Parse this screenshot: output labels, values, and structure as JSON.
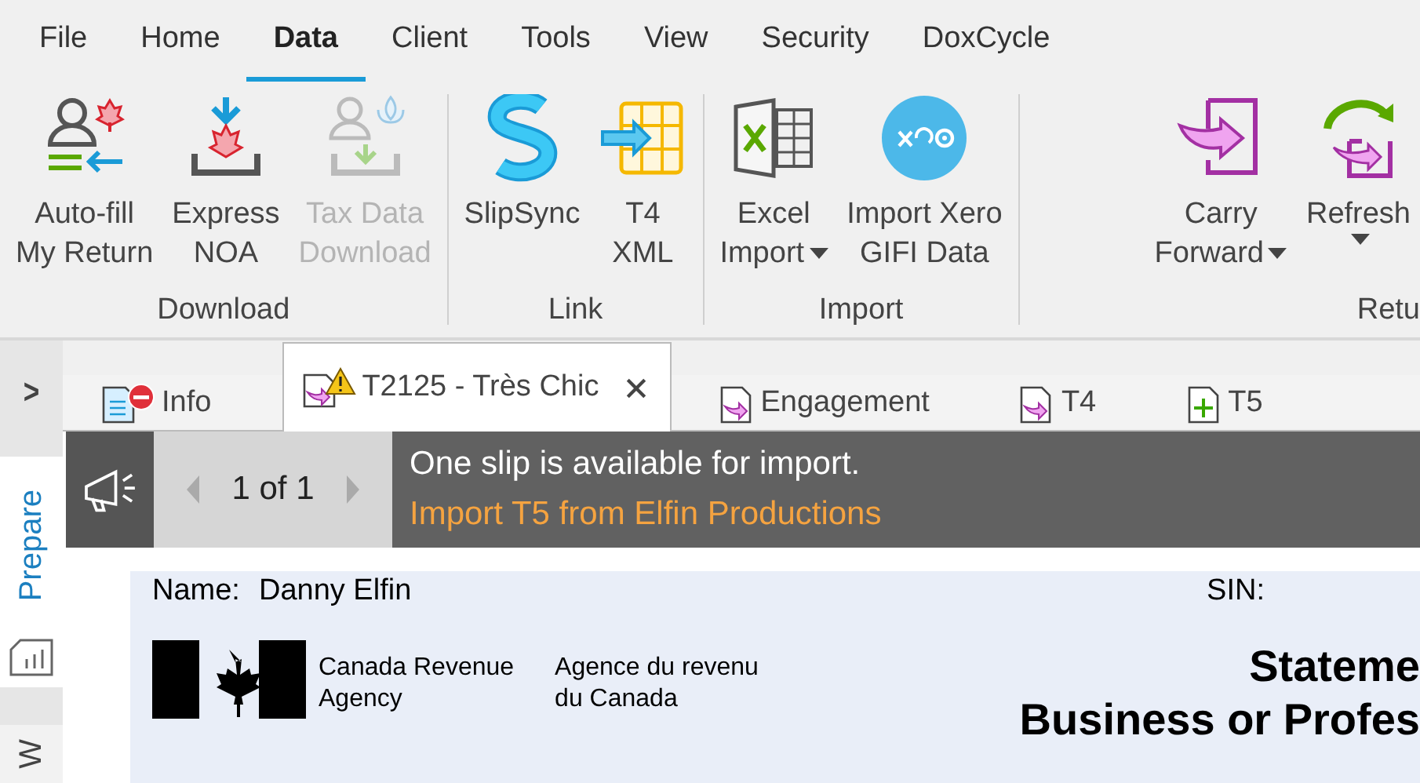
{
  "menu_tabs": [
    {
      "label": "File",
      "selected": false
    },
    {
      "label": "Home",
      "selected": false
    },
    {
      "label": "Data",
      "selected": true
    },
    {
      "label": "Client",
      "selected": false
    },
    {
      "label": "Tools",
      "selected": false
    },
    {
      "label": "View",
      "selected": false
    },
    {
      "label": "Security",
      "selected": false
    },
    {
      "label": "DoxCycle",
      "selected": false
    }
  ],
  "ribbon_groups": [
    {
      "label": "Download",
      "buttons": [
        {
          "kind": "autofill",
          "lines": [
            "Auto-fill",
            "My Return"
          ],
          "disabled": false,
          "dropdown": false
        },
        {
          "kind": "noa",
          "lines": [
            "Express",
            "NOA"
          ],
          "disabled": false,
          "dropdown": false
        },
        {
          "kind": "taxdata",
          "lines": [
            "Tax Data",
            "Download"
          ],
          "disabled": true,
          "dropdown": false
        }
      ]
    },
    {
      "label": "Link",
      "buttons": [
        {
          "kind": "slipsync",
          "lines": [
            "SlipSync"
          ],
          "disabled": false,
          "dropdown": false
        },
        {
          "kind": "xml",
          "lines": [
            "T4",
            "XML"
          ],
          "disabled": false,
          "dropdown": false
        }
      ]
    },
    {
      "label": "Import",
      "buttons": [
        {
          "kind": "excel",
          "lines": [
            "Excel",
            "Import"
          ],
          "disabled": false,
          "dropdown": true
        },
        {
          "kind": "xero",
          "lines": [
            "Import Xero",
            "GIFI Data"
          ],
          "disabled": false,
          "dropdown": false
        }
      ]
    },
    {
      "label": "Retu",
      "buttons": [
        {
          "kind": "carry",
          "lines": [
            "Carry",
            "Forward"
          ],
          "disabled": false,
          "dropdown": true
        },
        {
          "kind": "refresh",
          "lines": [
            "Refresh"
          ],
          "disabled": false,
          "dropdown": true
        }
      ]
    }
  ],
  "sidebar": {
    "expand_glyph": ">",
    "tabs": [
      {
        "label": "Prepare",
        "selected": true
      },
      {
        "label": "W",
        "selected": false
      }
    ]
  },
  "doc_tabs": [
    {
      "kind": "info",
      "label": "Info",
      "selected": false,
      "closable": false
    },
    {
      "kind": "warning",
      "label": "T2125 - Très Chic",
      "selected": true,
      "closable": true
    },
    {
      "kind": "form",
      "label": "Engagement",
      "selected": false,
      "closable": false
    },
    {
      "kind": "form",
      "label": "T4",
      "selected": false,
      "closable": false
    },
    {
      "kind": "add",
      "label": "T5",
      "selected": false,
      "closable": false
    }
  ],
  "notification": {
    "pager": "1 of 1",
    "message": "One slip is available for import.",
    "link": "Import T5 from Elfin Productions"
  },
  "form": {
    "name_label": "Name:",
    "name_value": "Danny Elfin",
    "sin_label": "SIN:",
    "agency_en": [
      "Canada Revenue",
      "Agency"
    ],
    "agency_fr": [
      "Agence du revenu",
      "du Canada"
    ],
    "title_lines": [
      "Stateme",
      "Business or Profes"
    ]
  }
}
